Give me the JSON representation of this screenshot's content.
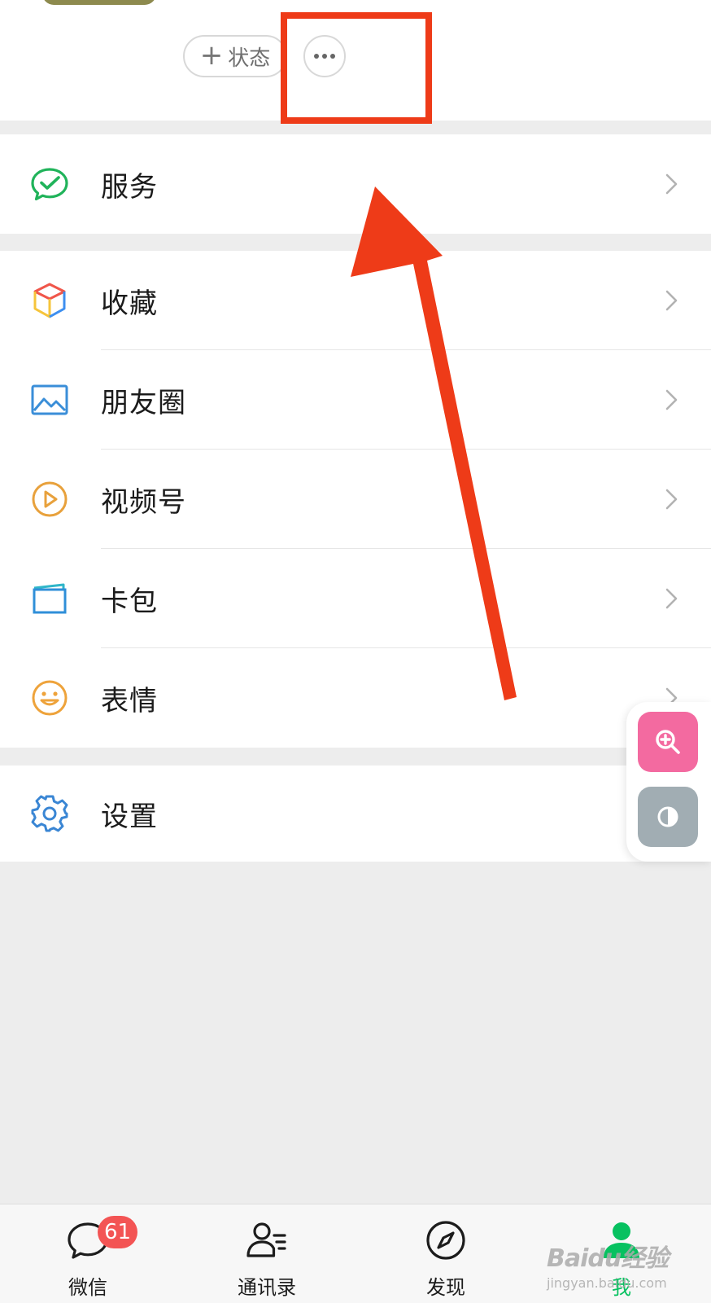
{
  "profile": {
    "status_label": "状态",
    "plus_glyph": "+"
  },
  "menu": {
    "services": {
      "label": "服务",
      "icon": "wechat-pay-icon"
    },
    "group2": [
      {
        "label": "收藏",
        "icon": "favorites-cube-icon"
      },
      {
        "label": "朋友圈",
        "icon": "moments-picture-icon"
      },
      {
        "label": "视频号",
        "icon": "channels-play-icon"
      },
      {
        "label": "卡包",
        "icon": "card-wallet-icon"
      },
      {
        "label": "表情",
        "icon": "emoji-smile-icon"
      }
    ],
    "settings": {
      "label": "设置",
      "icon": "settings-gear-icon"
    }
  },
  "tabbar": {
    "tabs": [
      {
        "label": "微信",
        "icon": "chat-bubble-icon",
        "badge": "61"
      },
      {
        "label": "通讯录",
        "icon": "contacts-icon"
      },
      {
        "label": "发现",
        "icon": "compass-icon"
      },
      {
        "label": "我",
        "icon": "person-icon",
        "active": true
      }
    ]
  },
  "watermark": {
    "line1": "Baidu经验",
    "line2": "jingyan.baidu.com"
  },
  "colors": {
    "accent_green": "#07c160",
    "annotation_red": "#ee3b18",
    "badge_red": "#f35454",
    "zoom_pink": "#f36aa0"
  }
}
